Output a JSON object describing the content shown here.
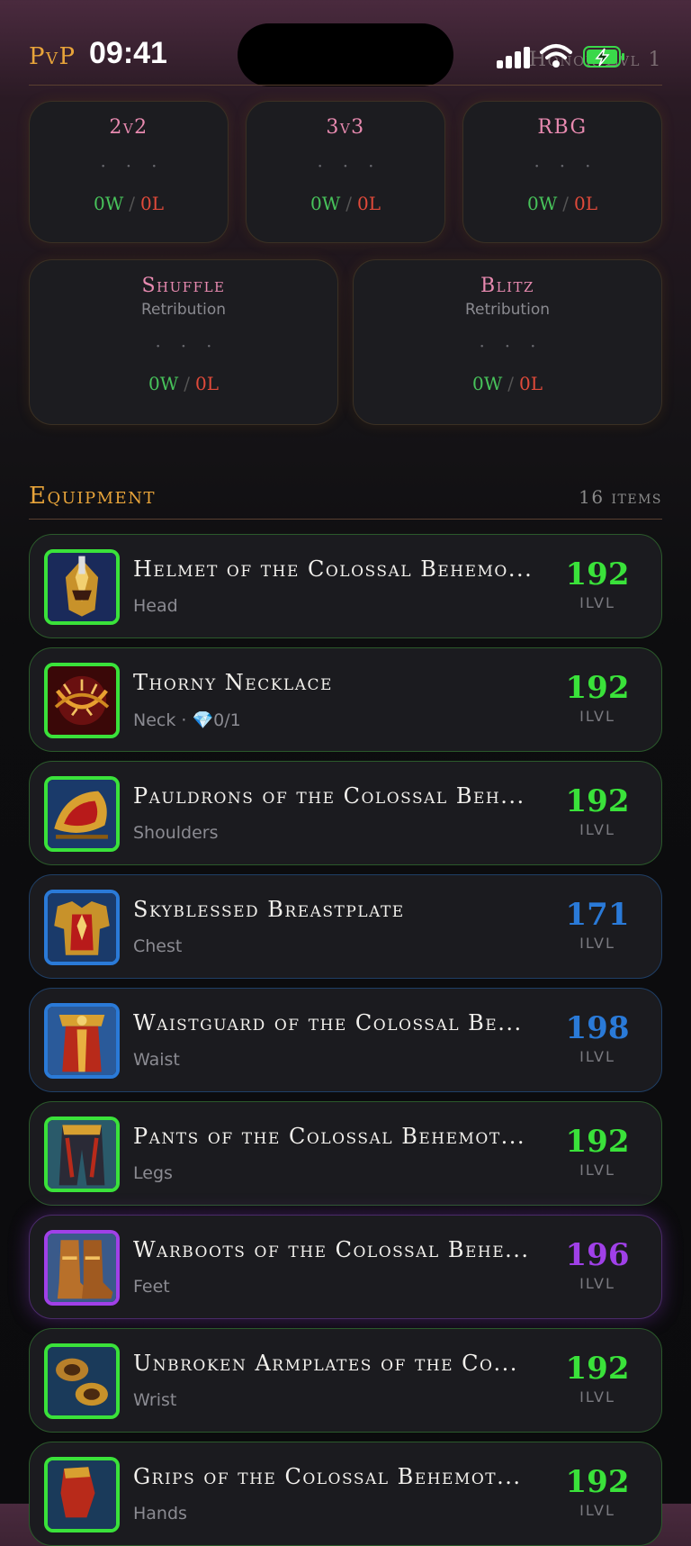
{
  "status_bar": {
    "time": "09:41"
  },
  "header": {
    "title": "PvP",
    "honor": "Honor Lvl 1"
  },
  "brackets": [
    {
      "name": "2v2",
      "spec": "",
      "wins": "0W",
      "losses": "0L"
    },
    {
      "name": "3v3",
      "spec": "",
      "wins": "0W",
      "losses": "0L"
    },
    {
      "name": "RBG",
      "spec": "",
      "wins": "0W",
      "losses": "0L"
    },
    {
      "name": "Shuffle",
      "spec": "Retribution",
      "wins": "0W",
      "losses": "0L"
    },
    {
      "name": "Blitz",
      "spec": "Retribution",
      "wins": "0W",
      "losses": "0L"
    }
  ],
  "equipment": {
    "title": "Equipment",
    "count": "16 items",
    "ilvl_label": "ILVL",
    "items": [
      {
        "name": "Helmet of the Colossal Behemo...",
        "slot": "Head",
        "ilvl": "192",
        "quality": "uncommon",
        "color": "#3ae23a"
      },
      {
        "name": "Thorny Necklace",
        "slot": "Neck · 💎0/1",
        "ilvl": "192",
        "quality": "uncommon",
        "color": "#3ae23a"
      },
      {
        "name": "Pauldrons of the Colossal Beh...",
        "slot": "Shoulders",
        "ilvl": "192",
        "quality": "uncommon",
        "color": "#3ae23a"
      },
      {
        "name": "Skyblessed Breastplate",
        "slot": "Chest",
        "ilvl": "171",
        "quality": "rare",
        "color": "#2a7ad8"
      },
      {
        "name": "Waistguard of the Colossal Be...",
        "slot": "Waist",
        "ilvl": "198",
        "quality": "rare",
        "color": "#2a7ad8"
      },
      {
        "name": "Pants of the Colossal Behemot...",
        "slot": "Legs",
        "ilvl": "192",
        "quality": "uncommon",
        "color": "#3ae23a"
      },
      {
        "name": "Warboots of the Colossal Behe...",
        "slot": "Feet",
        "ilvl": "196",
        "quality": "epic",
        "color": "#a040e8"
      },
      {
        "name": "Unbroken Armplates of the Co...",
        "slot": "Wrist",
        "ilvl": "192",
        "quality": "uncommon",
        "color": "#3ae23a"
      },
      {
        "name": "Grips of the Colossal Behemot...",
        "slot": "Hands",
        "ilvl": "192",
        "quality": "uncommon",
        "color": "#3ae23a"
      }
    ]
  }
}
